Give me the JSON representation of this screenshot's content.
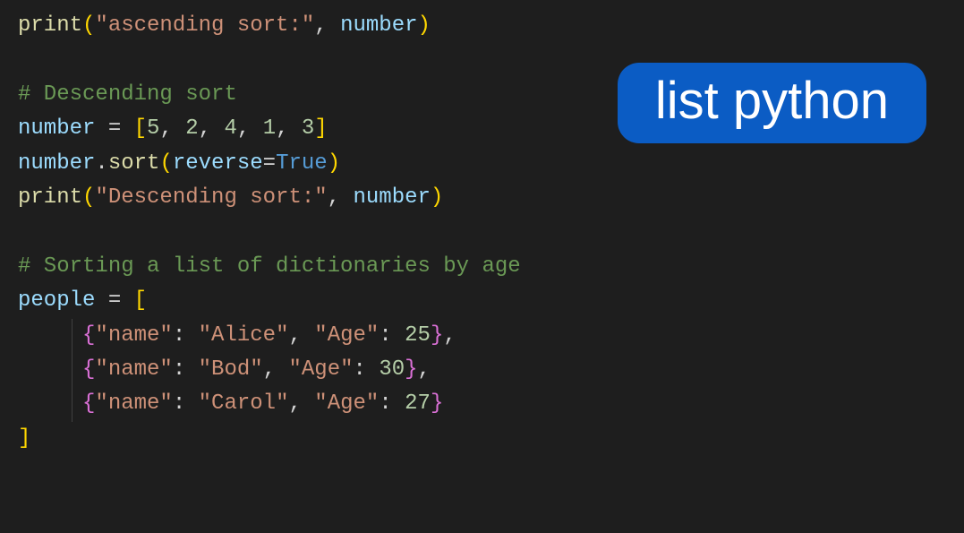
{
  "badge": {
    "label": "list python"
  },
  "code": {
    "l1": {
      "fn": "print",
      "str": "\"ascending sort:\"",
      "var": "number"
    },
    "l3_comment": "# Descending sort",
    "l4": {
      "var": "number",
      "nums": [
        "5",
        "2",
        "4",
        "1",
        "3"
      ]
    },
    "l5": {
      "var": "number",
      "method": "sort",
      "arg_key": "reverse",
      "arg_val": "True"
    },
    "l6": {
      "fn": "print",
      "str": "\"Descending sort:\"",
      "var": "number"
    },
    "l8_comment": "# Sorting a list of dictionaries by age",
    "l9_var": "people",
    "dicts": [
      {
        "k1": "\"name\"",
        "v1": "\"Alice\"",
        "k2": "\"Age\"",
        "v2": "25"
      },
      {
        "k1": "\"name\"",
        "v1": "\"Bod\"",
        "k2": "\"Age\"",
        "v2": "30"
      },
      {
        "k1": "\"name\"",
        "v1": "\"Carol\"",
        "k2": "\"Age\"",
        "v2": "27"
      }
    ]
  }
}
